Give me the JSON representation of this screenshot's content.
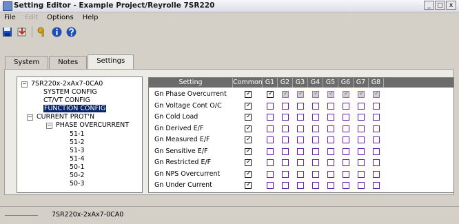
{
  "window": {
    "title": "Setting Editor - Example Project/Reyrolle 7SR220",
    "minimize": "_",
    "restore": "□",
    "close": "x"
  },
  "menu": [
    {
      "label": "File"
    },
    {
      "label": "Edit"
    },
    {
      "label": "Options"
    },
    {
      "label": "Help"
    }
  ],
  "toolbar": [
    {
      "name": "save-icon",
      "color": "#1e4fb5"
    },
    {
      "name": "download-icon",
      "color": "#b5381e"
    },
    {
      "name": "key-icon",
      "color": "#d9a520"
    },
    {
      "name": "info-icon",
      "color": "#1e4fb5"
    },
    {
      "name": "help-icon",
      "color": "#1e4fb5"
    }
  ],
  "tabs": [
    {
      "label": "System"
    },
    {
      "label": "Notes"
    },
    {
      "label": "Settings",
      "active": true
    }
  ],
  "tree": [
    {
      "label": "7SR220x-2xAx7-0CA0",
      "toggle": "−"
    },
    {
      "label": "SYSTEM CONFIG"
    },
    {
      "label": "CT/VT CONFIG"
    },
    {
      "label": "FUNCTION CONFIG",
      "selected": true
    },
    {
      "label": "CURRENT PROT'N",
      "toggle": "−"
    },
    {
      "label": "PHASE OVERCURRENT",
      "toggle": "−"
    },
    {
      "label": "51-1"
    },
    {
      "label": "51-2"
    },
    {
      "label": "51-3"
    },
    {
      "label": "51-4"
    },
    {
      "label": "50-1"
    },
    {
      "label": "50-2"
    },
    {
      "label": "50-3"
    }
  ],
  "grid": {
    "columns": [
      "Setting",
      "Common",
      "G1",
      "G2",
      "G3",
      "G4",
      "G5",
      "G6",
      "G7",
      "G8"
    ],
    "check_glyph": "✓",
    "rows": [
      {
        "setting": "Gn Phase Overcurrent",
        "common": true,
        "groups": [
          true,
          true,
          true,
          true,
          true,
          true,
          true,
          true
        ],
        "groups_disabled": true
      },
      {
        "setting": "Gn Voltage Cont O/C",
        "common": true,
        "groups": [
          false,
          false,
          false,
          false,
          false,
          false,
          false,
          false
        ]
      },
      {
        "setting": "Gn Cold Load",
        "common": true,
        "groups": [
          false,
          false,
          false,
          false,
          false,
          false,
          false,
          false
        ]
      },
      {
        "setting": "Gn Derived E/F",
        "common": true,
        "groups": [
          false,
          false,
          false,
          false,
          false,
          false,
          false,
          false
        ]
      },
      {
        "setting": "Gn Measured E/F",
        "common": true,
        "groups": [
          false,
          false,
          false,
          false,
          false,
          false,
          false,
          false
        ]
      },
      {
        "setting": "Gn Sensitive E/F",
        "common": true,
        "groups": [
          false,
          false,
          false,
          false,
          false,
          false,
          false,
          false
        ]
      },
      {
        "setting": "Gn Restricted E/F",
        "common": true,
        "groups": [
          false,
          false,
          false,
          false,
          false,
          false,
          false,
          false
        ]
      },
      {
        "setting": "Gn NPS Overcurrent",
        "common": true,
        "groups": [
          false,
          false,
          false,
          false,
          false,
          false,
          false,
          false
        ]
      },
      {
        "setting": "Gn Under Current",
        "common": true,
        "groups": [
          false,
          false,
          false,
          false,
          false,
          false,
          false,
          false
        ]
      }
    ]
  },
  "status": {
    "text": "7SR220x-2xAx7-0CA0"
  }
}
